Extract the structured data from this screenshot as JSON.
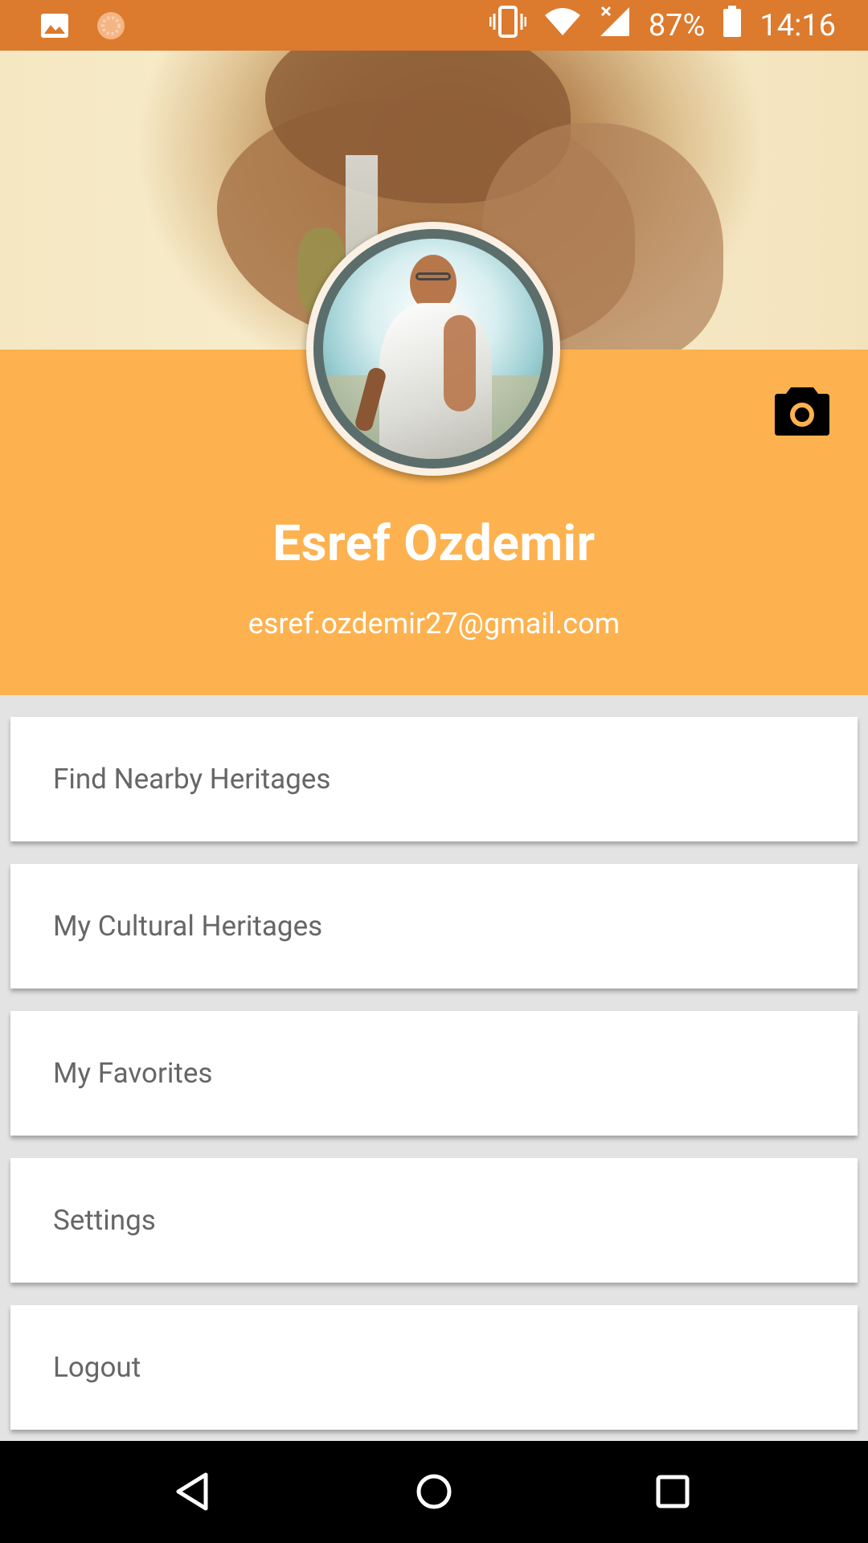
{
  "status_bar": {
    "battery": "87%",
    "time": "14:16",
    "left_icons": [
      "image-notification-icon",
      "sync-notification-icon"
    ],
    "right_icons": [
      "vibrate-icon",
      "wifi-icon",
      "signal-icon",
      "battery-icon"
    ]
  },
  "profile": {
    "name": "Esref Ozdemir",
    "email": "esref.ozdemir27@gmail.com",
    "camera_icon": "camera-icon"
  },
  "menu": {
    "items": [
      {
        "label": "Find Nearby Heritages"
      },
      {
        "label": "My Cultural Heritages"
      },
      {
        "label": "My Favorites"
      },
      {
        "label": "Settings"
      },
      {
        "label": "Logout"
      }
    ]
  },
  "nav_bar": {
    "icons": [
      "back-icon",
      "home-icon",
      "recents-icon"
    ]
  },
  "colors": {
    "status_bar": "#dc7a2d",
    "profile_panel": "#fdb24f",
    "menu_text": "#666666",
    "background": "#e3e3e3"
  }
}
